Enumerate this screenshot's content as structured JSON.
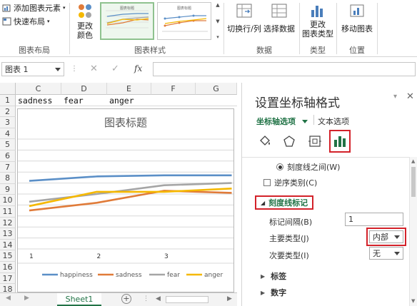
{
  "ribbon": {
    "add_element": "添加图表元素",
    "quick_layout": "快速布局",
    "group_layout": "图表布局",
    "change_color": "更改\n颜色",
    "group_styles": "图表样式",
    "switch_row_col": "切换行/列",
    "select_data": "选择数据",
    "group_data": "数据",
    "change_type": "更改\n图表类型",
    "group_type": "类型",
    "move_chart": "移动图表",
    "group_location": "位置"
  },
  "formula_bar": {
    "name_box": "图表 1",
    "fx": "fx",
    "cancel": "✕",
    "confirm": "✓"
  },
  "grid": {
    "columns": [
      "C",
      "D",
      "E",
      "F",
      "G"
    ],
    "rows": [
      "1",
      "2",
      "3",
      "4",
      "5",
      "6",
      "7",
      "8",
      "9",
      "10",
      "11",
      "12",
      "13",
      "14",
      "15",
      "16",
      "17",
      "18"
    ],
    "row1_cells": [
      "sadness",
      "fear",
      "anger"
    ],
    "sheet_tab": "Sheet1"
  },
  "chart_data": {
    "type": "line",
    "title": "图表标题",
    "categories": [
      "1",
      "2",
      "3"
    ],
    "series": [
      {
        "name": "happiness",
        "color": "#5b8fc7",
        "values": [
          0.62,
          0.66,
          0.67,
          0.67
        ]
      },
      {
        "name": "sadness",
        "color": "#e07b39",
        "values": [
          0.35,
          0.42,
          0.53,
          0.51
        ]
      },
      {
        "name": "fear",
        "color": "#a5a5a5",
        "values": [
          0.43,
          0.5,
          0.58,
          0.6
        ]
      },
      {
        "name": "anger",
        "color": "#f5b800",
        "values": [
          0.39,
          0.52,
          0.52,
          0.55
        ]
      }
    ],
    "ylim": [
      0,
      1
    ],
    "gridlines": true,
    "legend_position": "bottom"
  },
  "pane": {
    "title": "设置坐标轴格式",
    "tab_axis_options": "坐标轴选项",
    "tab_text_options": "文本选项",
    "between_ticks": "刻度线之间(W)",
    "reverse_categories": "逆序类别(C)",
    "section_tick_marks": "刻度线标记",
    "interval_label": "标记间隔(B)",
    "interval_value": "1",
    "major_type_label": "主要类型(J)",
    "major_type_value": "内部",
    "minor_type_label": "次要类型(I)",
    "minor_type_value": "无",
    "section_labels": "标签",
    "section_number": "数字"
  },
  "icons": [
    "fill-bucket-icon",
    "pentagon-icon",
    "size-properties-icon",
    "bar-chart-icon"
  ]
}
